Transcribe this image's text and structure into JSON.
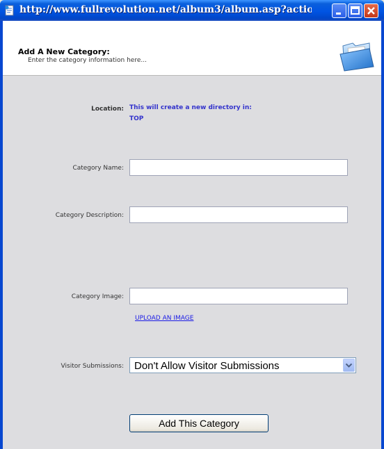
{
  "window": {
    "title": "http://www.fullrevolution.net/album3/album.asp?actio...",
    "buttons": [
      "minimize-icon",
      "maximize-icon",
      "close-icon"
    ]
  },
  "header": {
    "title": "Add A New Category:",
    "subtitle": "Enter the category information here...",
    "icon": "folder-icon"
  },
  "form": {
    "location_label": "Location:",
    "location_line1": "This will create a new directory in:",
    "location_line2": "TOP",
    "name_label": "Category Name:",
    "name_value": "",
    "description_label": "Category Description:",
    "description_value": "",
    "image_label": "Category Image:",
    "image_value": "",
    "upload_link": "UPLOAD AN IMAGE",
    "visitor_label": "Visitor Submissions:",
    "visitor_selected": "Don't Allow Visitor Submissions",
    "submit_label": "Add This Category"
  },
  "colors": {
    "titlebar": "#0054e3",
    "form_background": "#dddde0",
    "location_text": "#3333cc",
    "link": "#1a1ae6"
  }
}
